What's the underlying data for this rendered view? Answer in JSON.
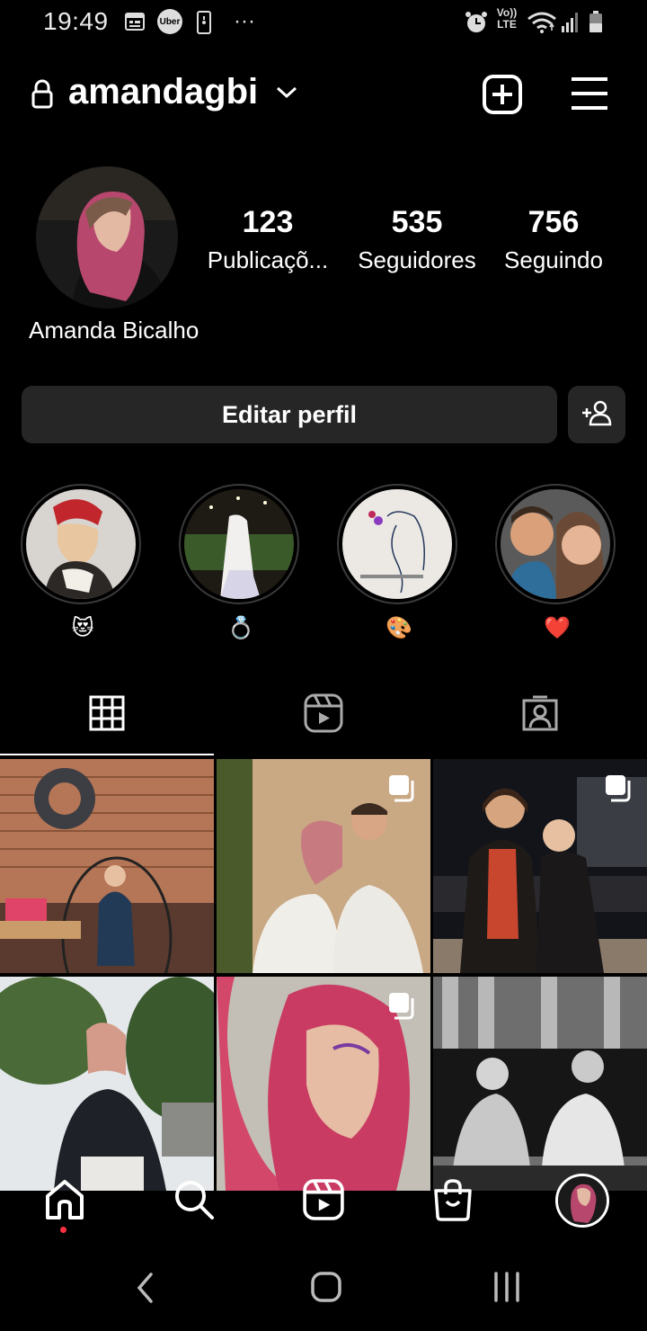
{
  "status_bar": {
    "time": "19:49",
    "icons": [
      "calendar-icon",
      "uber-icon",
      "phone-icon",
      "more-dots",
      "alarm-icon",
      "volte-icon",
      "wifi-icon",
      "signal-icon",
      "battery-icon"
    ],
    "uber_label": "Uber",
    "volte_label": "Vo)) LTE"
  },
  "header": {
    "username": "amandagbi",
    "icons": [
      "lock-icon",
      "chevron-down-icon",
      "new-post-icon",
      "menu-icon"
    ]
  },
  "profile": {
    "display_name": "Amanda Bicalho",
    "stats": [
      {
        "value": "123",
        "label": "Publicaçõ..."
      },
      {
        "value": "535",
        "label": "Seguidores"
      },
      {
        "value": "756",
        "label": "Seguindo"
      }
    ],
    "edit_button": "Editar perfil"
  },
  "highlights": [
    {
      "label": "😻"
    },
    {
      "label": "💍"
    },
    {
      "label": "🎨"
    },
    {
      "label": "❤️"
    }
  ],
  "tabs": [
    "grid-icon",
    "reels-icon",
    "tagged-icon"
  ],
  "posts": [
    {
      "scene": "cafe-swing-chair",
      "multi": false
    },
    {
      "scene": "couple-smiling",
      "multi": true
    },
    {
      "scene": "couple-night-street",
      "multi": true
    },
    {
      "scene": "woman-trees",
      "multi": false
    },
    {
      "scene": "pink-hair-closeup",
      "multi": true
    },
    {
      "scene": "black-white-bride",
      "multi": false
    }
  ],
  "bottom_nav": [
    "home-icon",
    "search-icon",
    "reels-icon",
    "shop-icon",
    "profile-avatar"
  ],
  "colors": {
    "background": "#000000",
    "button": "#262626",
    "notification": "#ff3040"
  }
}
